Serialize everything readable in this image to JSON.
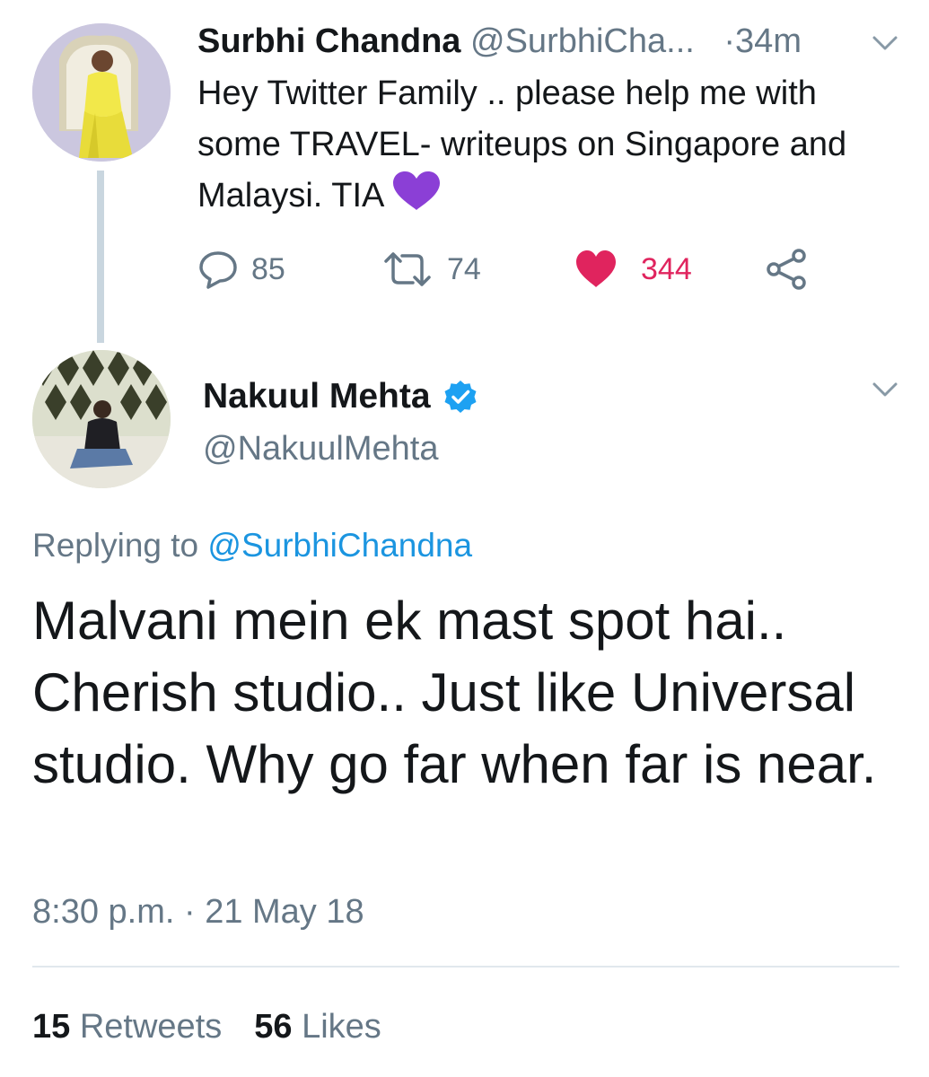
{
  "parent_tweet": {
    "name": "Surbhi Chandna",
    "handle": "@SurbhiCha...",
    "separator": "·",
    "time_ago": "34m",
    "text": "Hey Twitter Family .. please help me with some TRAVEL- writeups on Singapore and Malaysi. TIA",
    "text_emoji": "purple-heart",
    "replies": "85",
    "retweets": "74",
    "likes": "344",
    "liked": true,
    "like_color": "#e0245e"
  },
  "reply_tweet": {
    "name": "Nakuul Mehta",
    "verified": true,
    "handle": "@NakuulMehta",
    "replying_label": "Replying to",
    "replying_to": "@SurbhiChandna",
    "text": "Malvani mein ek mast spot hai.. Cherish studio.. Just like Universal studio. Why go far when far is near.",
    "timestamp": "8:30 p.m. · 21 May 18",
    "retweets_count": "15",
    "retweets_label": "Retweets",
    "likes_count": "56",
    "likes_label": "Likes"
  },
  "colors": {
    "text_primary": "#14171a",
    "text_secondary": "#657786",
    "link": "#1b95e0",
    "like": "#e0245e",
    "verified": "#1da1f2",
    "emoji_heart": "#8b3fd6"
  },
  "icons": {
    "reply": "reply-icon",
    "retweet": "retweet-icon",
    "like": "heart-icon",
    "share": "share-icon",
    "menu": "chevron-down-icon",
    "verified": "verified-badge-icon"
  }
}
